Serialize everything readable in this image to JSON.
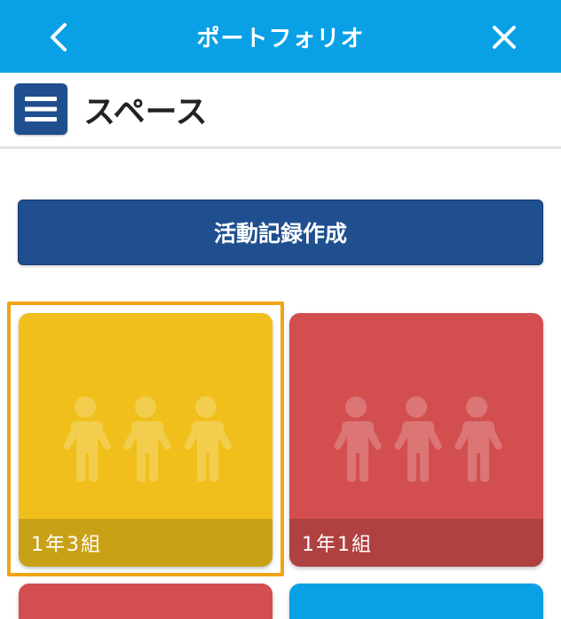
{
  "topbar": {
    "title": "ポートフォリオ",
    "back_icon": "chevron-left-icon",
    "close_icon": "close-icon",
    "color": "#0aa0e6"
  },
  "subheader": {
    "menu_icon": "hamburger-menu-icon",
    "heading": "スペース"
  },
  "create_button": {
    "label": "活動記録作成",
    "color": "#1f4f8f"
  },
  "spaces": [
    {
      "label": "1年3組",
      "color": "#f0bf1c",
      "bar_color": "#c9a117",
      "icon": "group-people-icon",
      "selected": true
    },
    {
      "label": "1年1組",
      "color": "#d34f4f",
      "bar_color": "#b04141",
      "icon": "group-people-icon",
      "selected": false
    },
    {
      "label": "",
      "color": "#d34f4f",
      "icon": "group-people-icon",
      "selected": false
    },
    {
      "label": "",
      "color": "#0aa0e6",
      "icon": "group-people-icon",
      "selected": false
    }
  ],
  "selection_color": "#f0a414"
}
